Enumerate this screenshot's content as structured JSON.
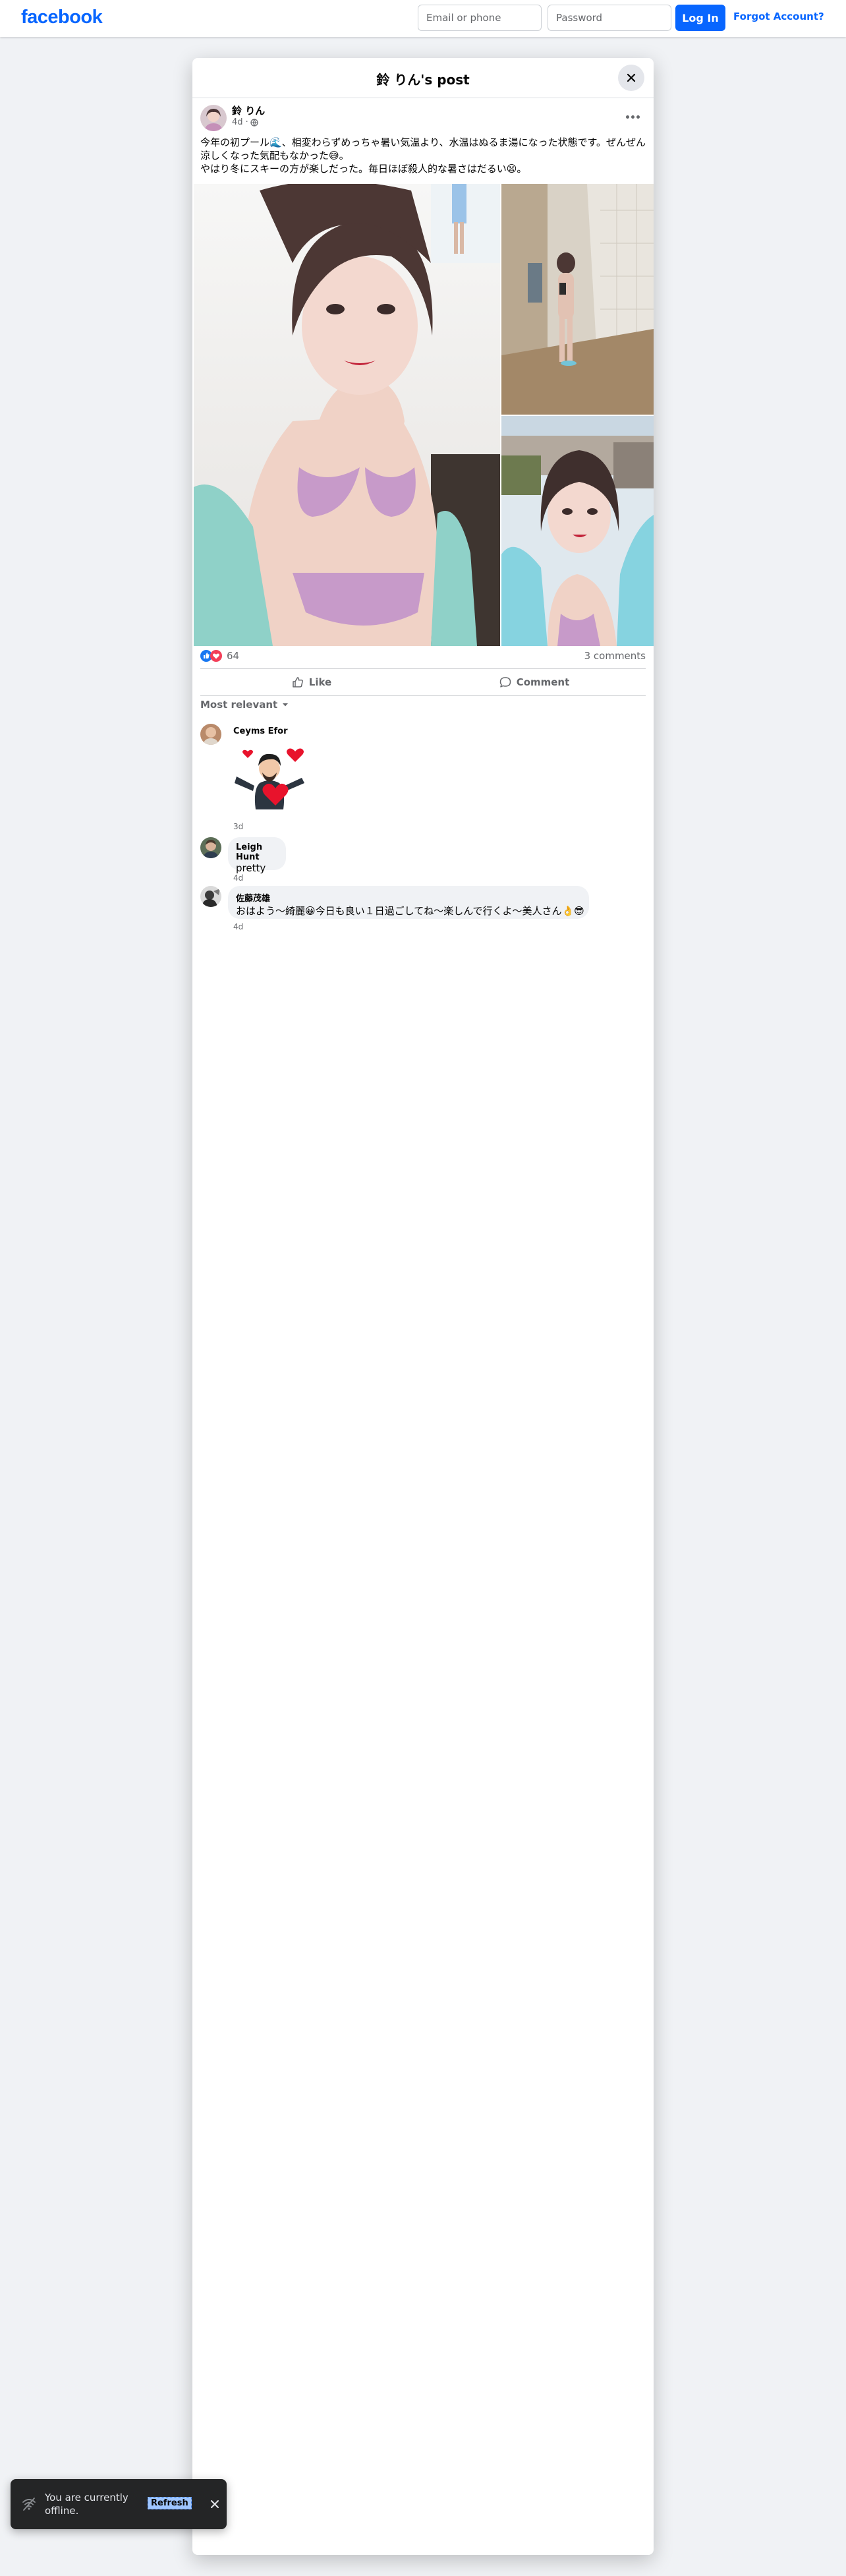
{
  "topbar": {
    "logo": "facebook",
    "email_placeholder": "Email or phone",
    "password_placeholder": "Password",
    "login_label": "Log In",
    "forgot_label": "Forgot Account?"
  },
  "modal": {
    "title": "鈴 りん's post"
  },
  "post": {
    "author": "鈴 りん",
    "time": "4d ·",
    "text_lines": [
      "今年の初プール🌊、相変わらずめっちゃ暑い気温より、水温はぬるま湯になった状態です。ぜんぜん",
      "涼しくなった気配もなかった😅。",
      "やはり冬にスキーの方が楽しだった。毎日ほぼ殺人的な暑さはだるい😫。"
    ],
    "reaction_count": "64",
    "comments_count": "3 comments",
    "like_label": "Like",
    "comment_label": "Comment",
    "sort_label": "Most relevant"
  },
  "comments": [
    {
      "name": "Ceyms Efor",
      "time": "3d",
      "sticker": "heart-sticker"
    },
    {
      "name": "Leigh Hunt",
      "text": "pretty",
      "time": "4d"
    },
    {
      "name": "佐藤茂雄",
      "text": "おはよう〜綺麗😀今日も良い１日過ごしてね〜楽しんで行くよ〜美人さん👌😎",
      "time": "4d"
    }
  ],
  "toast": {
    "message": "You are currently offline.",
    "refresh_label": "Refresh"
  },
  "colors": {
    "brand": "#0866ff",
    "page_bg": "#f0f2f5",
    "secondary_text": "#65676b"
  }
}
